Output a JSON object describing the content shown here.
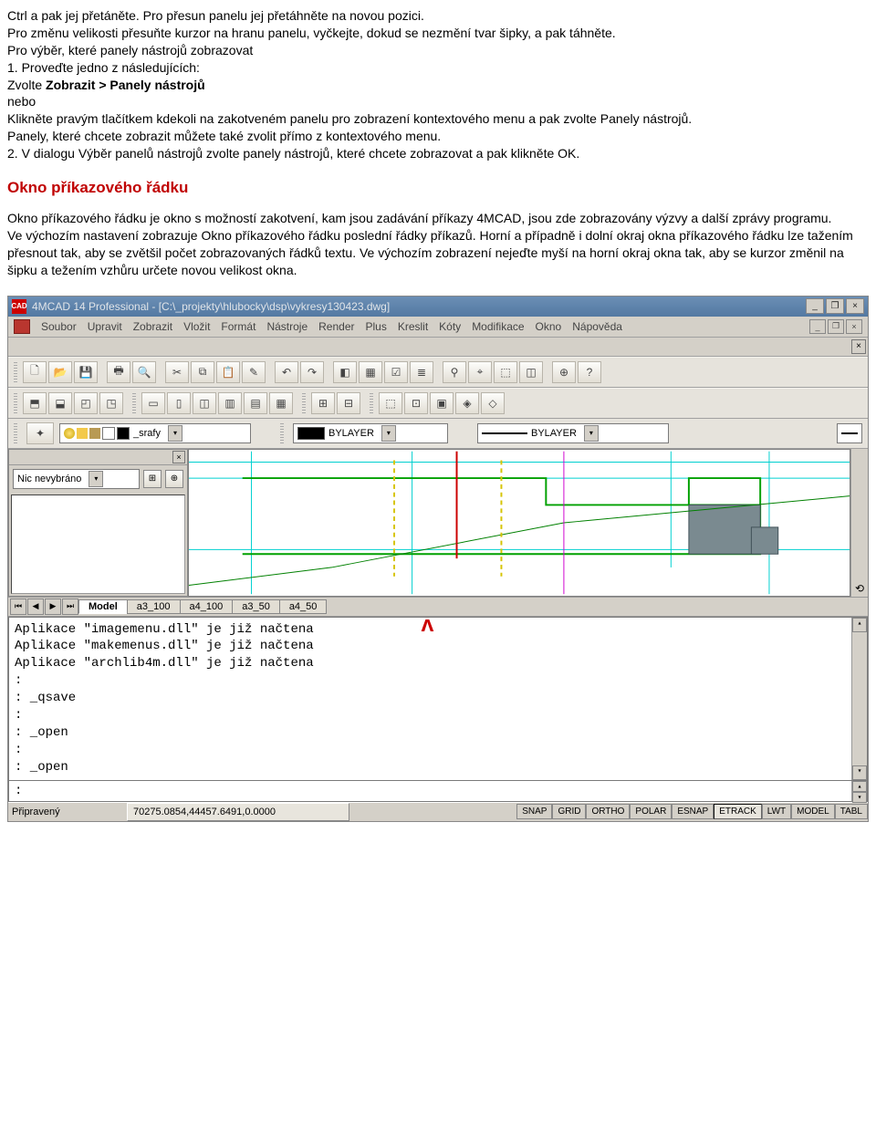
{
  "doc": {
    "p1": "Ctrl a pak jej přetáněte. Pro přesun panelu jej přetáhněte na novou pozici.",
    "p2": "Pro změnu velikosti přesuňte kurzor na hranu panelu, vyčkejte, dokud se nezmění tvar šipky, a pak táhněte.",
    "p3": "Pro výběr, které panely nástrojů zobrazovat",
    "p4": "1. Proveďte jedno z následujících:",
    "p5a": "Zvolte ",
    "p5b": "Zobrazit > Panely nástrojů",
    "p6": "nebo",
    "p7": "Klikněte pravým tlačítkem kdekoli na zakotveném panelu pro zobrazení kontextového menu a pak zvolte Panely nástrojů.",
    "p8": "Panely, které chcete zobrazit můžete také zvolit přímo z kontextového menu.",
    "p9": "2. V dialogu Výběr panelů nástrojů zvolte panely nástrojů, které chcete zobrazovat a pak klikněte OK.",
    "h1": "Okno příkazového řádku",
    "p10": "Okno příkazového řádku je okno s možností zakotvení, kam jsou zadávání příkazy 4MCAD, jsou zde zobrazovány výzvy a další zprávy programu.",
    "p11": "Ve výchozím nastavení zobrazuje Okno příkazového řádku poslední řádky příkazů. Horní a případně i dolní okraj okna příkazového řádku lze tažením přesnout tak, aby se zvětšil počet zobrazovaných řádků textu. Ve výchozím zobrazení nejeďte myší na horní okraj okna tak, aby se kurzor změnil na šipku a težením vzhůru určete novou velikost okna."
  },
  "app": {
    "title": "4MCAD 14 Professional  -  [C:\\_projekty\\hlubocky\\dsp\\vykresy130423.dwg]",
    "logo": "CAD",
    "menu": [
      "Soubor",
      "Upravit",
      "Zobrazit",
      "Vložit",
      "Formát",
      "Nástroje",
      "Render",
      "Plus",
      "Kreslit",
      "Kóty",
      "Modifikace",
      "Okno",
      "Nápověda"
    ],
    "layer": {
      "name": "_srafy"
    },
    "bylayer1": "BYLAYER",
    "bylayer2": "BYLAYER",
    "selection": "Nic nevybráno",
    "tabs": [
      "Model",
      "a3_100",
      "a4_100",
      "a3_50",
      "a4_50"
    ],
    "cmd_lines": [
      "Aplikace \"imagemenu.dll\" je již načtena",
      "Aplikace \"makemenus.dll\" je již načtena",
      "Aplikace \"archlib4m.dll\" je již načtena",
      ":",
      ": _qsave",
      ":",
      ": _open",
      ":",
      ": _open"
    ],
    "cmd_prompt": ":",
    "status": {
      "ready": "Připravený",
      "coords": "70275.0854,44457.6491,0.0000",
      "toggles": [
        "SNAP",
        "GRID",
        "ORTHO",
        "POLAR",
        "ESNAP",
        "ETRACK",
        "LWT",
        "MODEL",
        "TABL"
      ],
      "active_toggle": "ETRACK"
    }
  }
}
